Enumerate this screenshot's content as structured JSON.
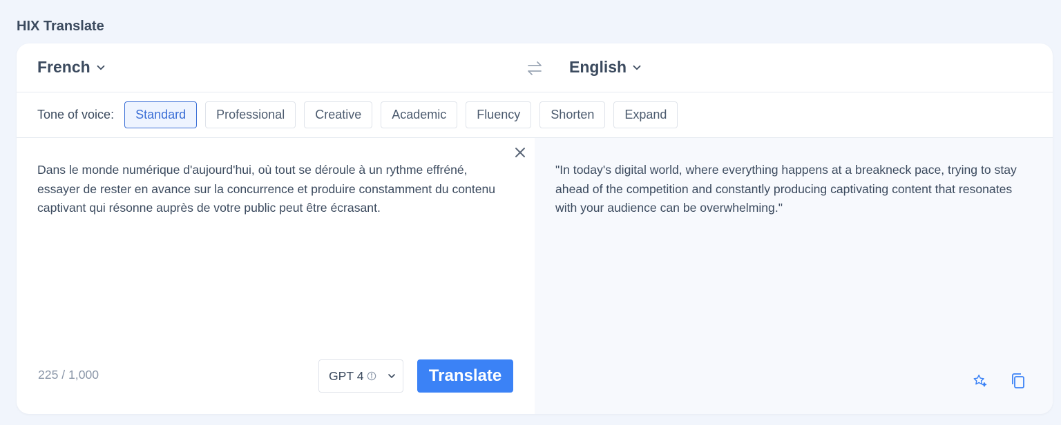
{
  "app": {
    "title": "HIX Translate"
  },
  "languages": {
    "source": "French",
    "target": "English"
  },
  "tone": {
    "label": "Tone of voice:",
    "options": [
      "Standard",
      "Professional",
      "Creative",
      "Academic",
      "Fluency",
      "Shorten",
      "Expand"
    ],
    "selected": "Standard"
  },
  "source": {
    "text": "Dans le monde numérique d'aujourd'hui, où tout se déroule à un rythme effréné, essayer de rester en avance sur la concurrence et produire constamment du contenu captivant qui résonne auprès de votre public peut être écrasant.",
    "char_count": "225 / 1,000"
  },
  "model": {
    "label": "GPT 4"
  },
  "actions": {
    "translate_label": "Translate"
  },
  "target": {
    "text": "\"In today's digital world, where everything happens at a breakneck pace, trying to stay ahead of the competition and constantly producing captivating content that resonates with your audience can be overwhelming.\""
  },
  "colors": {
    "accent": "#3b82f6",
    "active_tone": "#3b6fd6",
    "background": "#f1f5fc"
  }
}
